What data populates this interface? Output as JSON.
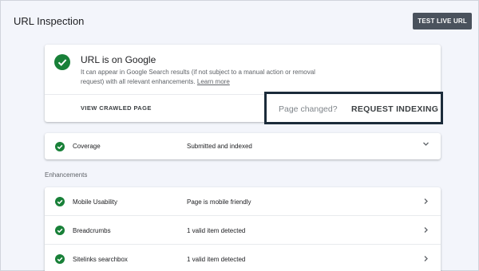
{
  "header": {
    "title": "URL Inspection",
    "test_live_label": "TEST LIVE URL"
  },
  "status": {
    "heading": "URL is on Google",
    "description": "It can appear in Google Search results (if not subject to a manual action or removal request) with all relevant enhancements.",
    "learn_more": "Learn more",
    "view_crawled_label": "VIEW CRAWLED PAGE",
    "page_changed": "Page changed?",
    "request_indexing_label": "REQUEST INDEXING"
  },
  "coverage": {
    "label": "Coverage",
    "value": "Submitted and indexed"
  },
  "enhancements": {
    "section_label": "Enhancements",
    "rows": [
      {
        "label": "Mobile Usability",
        "value": "Page is mobile friendly"
      },
      {
        "label": "Breadcrumbs",
        "value": "1 valid item detected"
      },
      {
        "label": "Sitelinks searchbox",
        "value": "1 valid item detected"
      }
    ]
  },
  "colors": {
    "success": "#188038",
    "button_bg": "#4a525d",
    "highlight_border": "#1b2b3a"
  }
}
